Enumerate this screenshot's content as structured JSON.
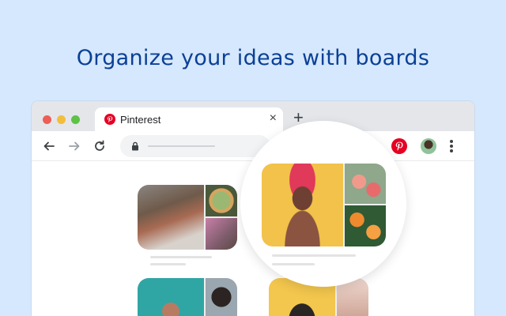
{
  "headline": "Organize your ideas with boards",
  "tab": {
    "title": "Pinterest",
    "close_glyph": "×",
    "new_tab_glyph": "+"
  },
  "brand": {
    "pinterest_red": "#e60023",
    "headline_blue": "#0b4096",
    "background": "#d6e8fd"
  },
  "toolbar": {
    "icons": [
      "back-arrow-icon",
      "forward-arrow-icon",
      "reload-icon",
      "lock-icon",
      "pinterest-extension-icon",
      "profile-avatar",
      "more-menu-icon"
    ]
  }
}
